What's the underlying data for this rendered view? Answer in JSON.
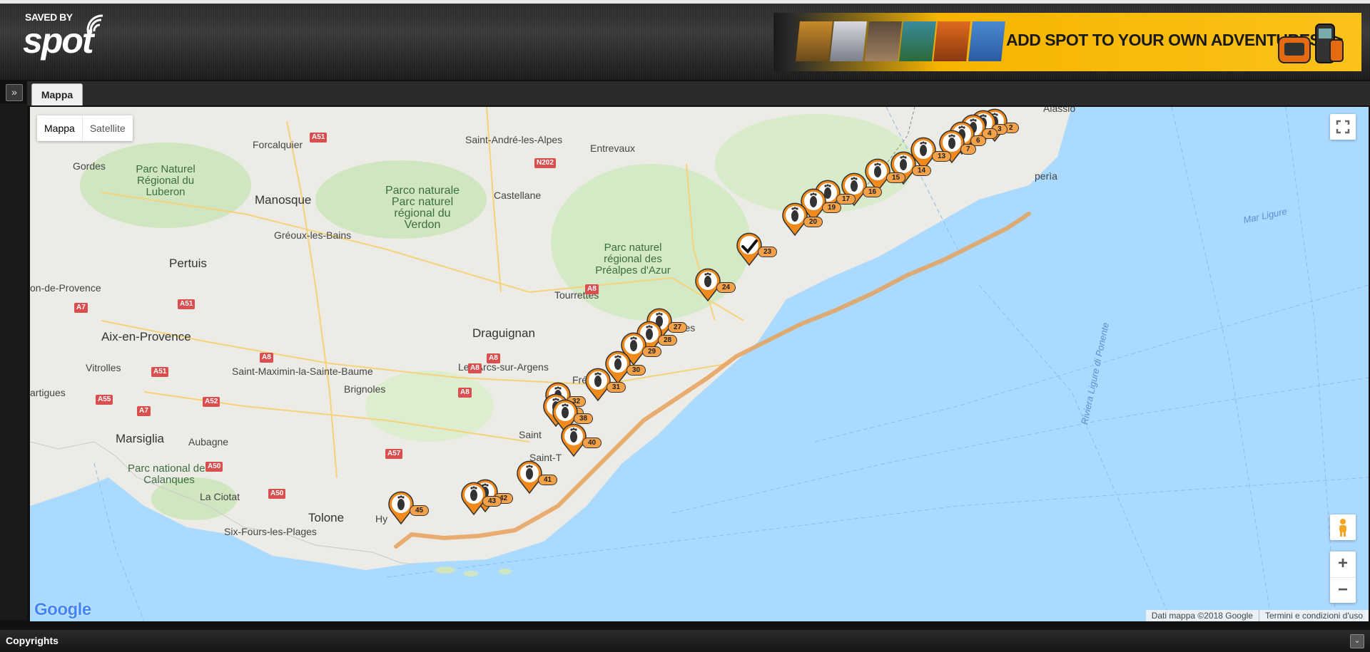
{
  "header": {
    "logo_saved_by": "SAVED BY",
    "logo_brand": "spot",
    "banner_text": "ADD SPOT TO YOUR OWN ADVENTURES >>"
  },
  "tabs": [
    {
      "label": "Mappa"
    }
  ],
  "map_controls": {
    "map_type": "Mappa",
    "satellite": "Satellite",
    "zoom_in": "+",
    "zoom_out": "−",
    "google_logo": "Google",
    "attribution": "Dati mappa ©2018 Google",
    "terms": "Termini e condizioni d'uso"
  },
  "footer": {
    "title": "Copyrights"
  },
  "place_labels": [
    {
      "text": "Alassio"
    },
    {
      "text": "Saint-André-les-Alpes"
    },
    {
      "text": "Entrevaux"
    },
    {
      "text": "Forcalquier"
    },
    {
      "text": "Gordes"
    },
    {
      "text": "Manosque"
    },
    {
      "text": "Castellane"
    },
    {
      "text": "Gréoux-les-Bains"
    },
    {
      "text": "Pertuis"
    },
    {
      "text": "on-de-Provence"
    },
    {
      "text": "Tourrettes"
    },
    {
      "text": "Aix-en-Provence"
    },
    {
      "text": "Draguignan"
    },
    {
      "text": "Vitrolles"
    },
    {
      "text": "Saint-Maximin-la-Sainte-Baume"
    },
    {
      "text": "Les Arcs-sur-Argens"
    },
    {
      "text": "Brignoles"
    },
    {
      "text": "artigues"
    },
    {
      "text": "Marsiglia"
    },
    {
      "text": "Aubagne"
    },
    {
      "text": "La Ciotat"
    },
    {
      "text": "Tolone"
    },
    {
      "text": "Six-Fours-les-Plages"
    },
    {
      "text": "Cannes"
    },
    {
      "text": "Fré"
    },
    {
      "text": "Saint"
    },
    {
      "text": "Saint-T"
    },
    {
      "text": "Hy"
    },
    {
      "text": "Ni"
    },
    {
      "text": "perìa"
    },
    {
      "text": "Mar Ligure"
    },
    {
      "text": "Riviera Ligure di Ponente"
    }
  ],
  "park_labels": [
    {
      "text": "Parc Naturel Régional du Luberon"
    },
    {
      "text": "Parco naturale Parc naturel régional du Verdon"
    },
    {
      "text": "Parc naturel régional des Préalpes d'Azur"
    },
    {
      "text": "Parc national des Calanques"
    }
  ],
  "road_labels": [
    "A51",
    "N202",
    "A51",
    "A7",
    "A8",
    "A8",
    "A8",
    "A51",
    "A52",
    "A7",
    "A55",
    "A57",
    "A50",
    "A50",
    "A8",
    "A8"
  ],
  "track_points": [
    {
      "label": "2",
      "type": "footprint"
    },
    {
      "label": "3",
      "type": "footprint"
    },
    {
      "label": "4",
      "type": "footprint"
    },
    {
      "label": "6",
      "type": "footprint"
    },
    {
      "label": "7",
      "type": "footprint"
    },
    {
      "label": "13",
      "type": "footprint"
    },
    {
      "label": "14",
      "type": "footprint"
    },
    {
      "label": "15",
      "type": "footprint"
    },
    {
      "label": "16",
      "type": "footprint"
    },
    {
      "label": "17",
      "type": "footprint"
    },
    {
      "label": "19",
      "type": "footprint"
    },
    {
      "label": "20",
      "type": "footprint"
    },
    {
      "label": "23",
      "type": "check"
    },
    {
      "label": "24",
      "type": "footprint"
    },
    {
      "label": "27",
      "type": "footprint"
    },
    {
      "label": "28",
      "type": "footprint"
    },
    {
      "label": "29",
      "type": "footprint"
    },
    {
      "label": "30",
      "type": "footprint"
    },
    {
      "label": "31",
      "type": "footprint"
    },
    {
      "label": "32",
      "type": "footprint"
    },
    {
      "label": "34",
      "type": "footprint"
    },
    {
      "label": "38",
      "type": "footprint"
    },
    {
      "label": "40",
      "type": "footprint"
    },
    {
      "label": "41",
      "type": "footprint"
    },
    {
      "label": "42",
      "type": "footprint"
    },
    {
      "label": "43",
      "type": "footprint"
    },
    {
      "label": "45",
      "type": "footprint"
    }
  ]
}
